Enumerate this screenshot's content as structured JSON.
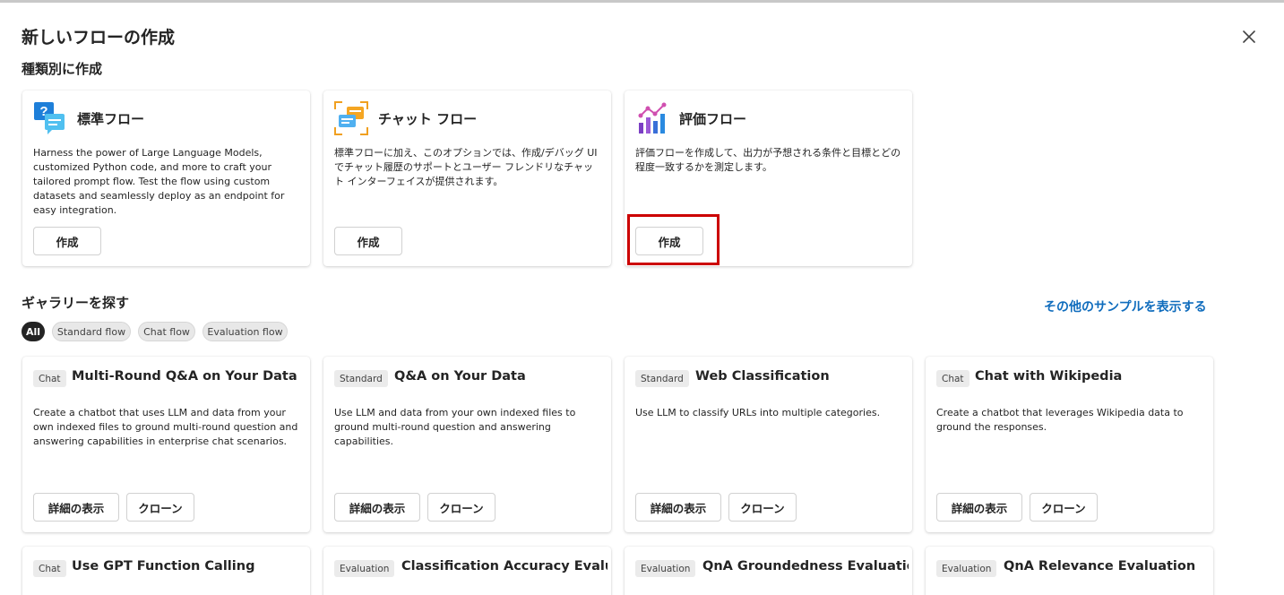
{
  "dialog": {
    "title": "新しいフローの作成",
    "close_icon": "close-icon"
  },
  "by_type": {
    "heading": "種類別に作成",
    "cards": [
      {
        "name": "標準フロー",
        "icon": "standard-flow-icon",
        "description": "Harness the power of Large Language Models, customized Python code, and more to craft your tailored prompt flow. Test the flow using custom datasets and seamlessly deploy as an endpoint for easy integration.",
        "button": "作成"
      },
      {
        "name": "チャット フロー",
        "icon": "chat-flow-icon",
        "description": "標準フローに加え、このオプションでは、作成/デバッグ UI でチャット履歴のサポートとユーザー フレンドリなチャット インターフェイスが提供されます。",
        "button": "作成"
      },
      {
        "name": "評価フロー",
        "icon": "evaluation-flow-icon",
        "description": "評価フローを作成して、出力が予想される条件と目標とどの程度一致するかを測定します。",
        "button": "作成",
        "highlighted": true
      }
    ]
  },
  "gallery": {
    "heading": "ギャラリーを探す",
    "more_samples_link": "その他のサンプルを表示する",
    "filters": [
      {
        "label": "All",
        "active": true
      },
      {
        "label": "Standard flow",
        "active": false
      },
      {
        "label": "Chat flow",
        "active": false
      },
      {
        "label": "Evaluation flow",
        "active": false
      }
    ],
    "cards": [
      {
        "tag": "Chat",
        "name": "Multi-Round Q&A on Your Data",
        "description": "Create a chatbot that uses LLM and data from your own indexed files to ground multi-round question and answering capabilities in enterprise chat scenarios.",
        "details_button": "詳細の表示",
        "clone_button": "クローン"
      },
      {
        "tag": "Standard",
        "name": "Q&A on Your Data",
        "description": "Use LLM and data from your own indexed files to ground multi-round question and answering capabilities.",
        "details_button": "詳細の表示",
        "clone_button": "クローン"
      },
      {
        "tag": "Standard",
        "name": "Web Classification",
        "description": "Use LLM to classify URLs into multiple categories.",
        "details_button": "詳細の表示",
        "clone_button": "クローン"
      },
      {
        "tag": "Chat",
        "name": "Chat with Wikipedia",
        "description": "Create a chatbot that leverages Wikipedia data to ground the responses.",
        "details_button": "詳細の表示",
        "clone_button": "クローン"
      },
      {
        "tag": "Chat",
        "name": "Use GPT Function Calling"
      },
      {
        "tag": "Evaluation",
        "name": "Classification Accuracy Evalu..."
      },
      {
        "tag": "Evaluation",
        "name": "QnA Groundedness Evaluation"
      },
      {
        "tag": "Evaluation",
        "name": "QnA Relevance Evaluation"
      }
    ]
  },
  "colors": {
    "accent_link": "#0f6cbd",
    "highlight_box": "#cc0000",
    "active_pill": "#242424"
  }
}
